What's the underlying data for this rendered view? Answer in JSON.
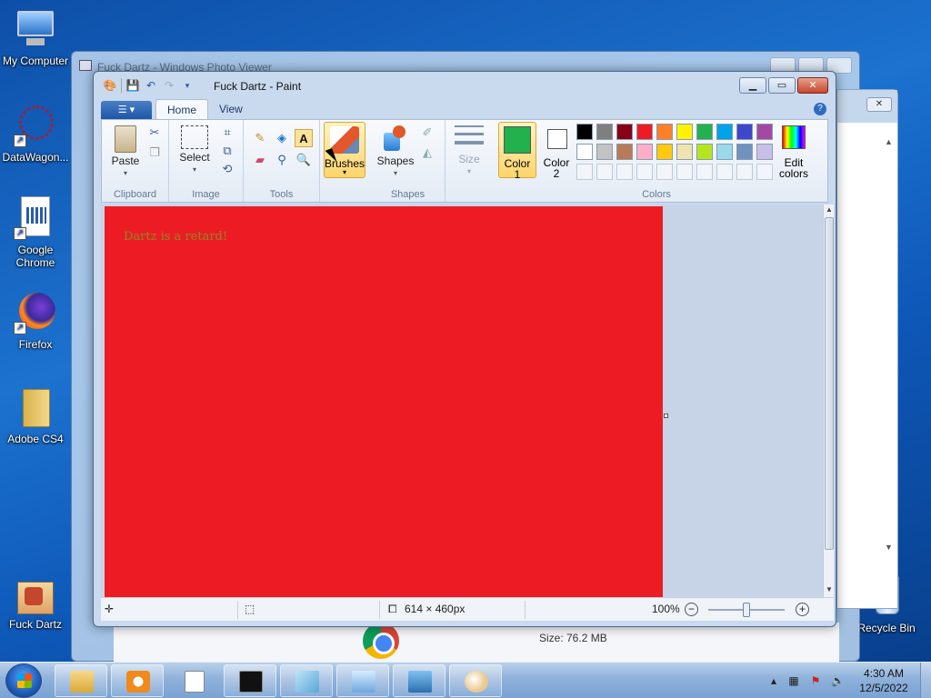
{
  "desktop": {
    "icons": [
      {
        "label": "My Computer"
      },
      {
        "label": "DataWagon..."
      },
      {
        "label": "Google Chrome"
      },
      {
        "label": "Firefox"
      },
      {
        "label": "Adobe CS4"
      },
      {
        "label": "Fuck Dartz"
      },
      {
        "label": "Recycle Bin"
      }
    ]
  },
  "photo_viewer": {
    "title": "Fuck Dartz - Windows Photo Viewer",
    "size_text": "Size: 76.2 MB"
  },
  "paint": {
    "title": "Fuck Dartz - Paint",
    "tabs": {
      "home": "Home",
      "view": "View"
    },
    "ribbon": {
      "paste": "Paste",
      "clipboard": "Clipboard",
      "select": "Select",
      "image": "Image",
      "tools": "Tools",
      "brushes": "Brushes",
      "shapes_btn": "Shapes",
      "shapes_group": "Shapes",
      "size": "Size",
      "color1": "Color\n1",
      "color1_a": "Color",
      "color1_b": "1",
      "color2_a": "Color",
      "color2_b": "2",
      "edit_colors_a": "Edit",
      "edit_colors_b": "colors",
      "colors_group": "Colors"
    },
    "color1_value": "#22b14c",
    "color2_value": "#ffffff",
    "palette_row1": [
      "#000000",
      "#7f7f7f",
      "#880015",
      "#ed1c24",
      "#ff7f27",
      "#fff200",
      "#22b14c",
      "#00a2e8",
      "#3f48cc",
      "#a349a4"
    ],
    "palette_row2": [
      "#ffffff",
      "#c3c3c3",
      "#b97a57",
      "#ffaec9",
      "#ffc90e",
      "#efe4b0",
      "#b5e61d",
      "#99d9ea",
      "#7092be",
      "#c8bfe7"
    ],
    "canvas": {
      "fill": "#ed1c24",
      "text": "Dartz is a retard!"
    },
    "status": {
      "dimensions": "614 × 460px",
      "zoom": "100%"
    }
  },
  "taskbar": {
    "time": "4:30 AM",
    "date": "12/5/2022"
  }
}
